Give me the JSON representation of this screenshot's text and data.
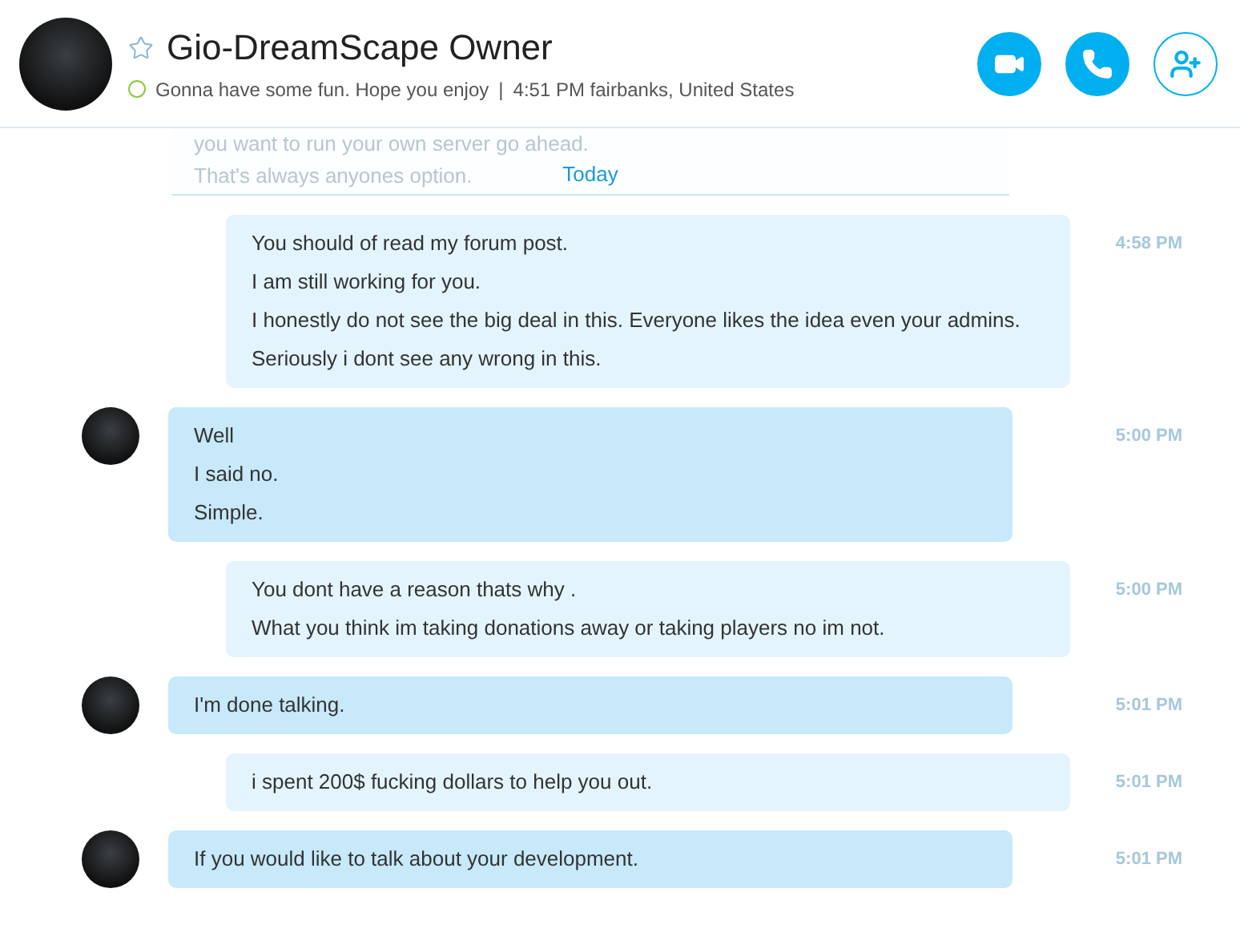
{
  "contact": {
    "name": "Gio-DreamScape Owner",
    "favorite": false,
    "online": true,
    "mood": "Gonna have some fun. Hope you enjoy",
    "separator": "|",
    "local_time": "4:51 PM fairbanks, United States"
  },
  "actions": [
    {
      "kind": "video",
      "filled": true
    },
    {
      "kind": "call",
      "filled": true
    },
    {
      "kind": "add",
      "filled": false
    }
  ],
  "earlier": {
    "lines": [
      "you want to run your own server go ahead.",
      "That's always anyones option."
    ]
  },
  "day_label": "Today",
  "messages": [
    {
      "kind": "sent",
      "time": "4:58 PM",
      "lines": [
        "You should of read my forum post.",
        "I am still working for you.",
        "I honestly do not see the big deal in this. Everyone likes the idea even your admins.",
        "Seriously i dont see any wrong in this."
      ]
    },
    {
      "kind": "received",
      "time": "5:00 PM",
      "lines": [
        "Well",
        "I said no.",
        "Simple."
      ]
    },
    {
      "kind": "sent",
      "time": "5:00 PM",
      "lines": [
        "You dont have a reason thats why .",
        "What you think im taking donations away or taking players no im not."
      ]
    },
    {
      "kind": "received",
      "time": "5:01 PM",
      "lines": [
        "I'm done talking."
      ]
    },
    {
      "kind": "sent",
      "time": "5:01 PM",
      "lines": [
        "i spent 200$ fucking dollars to help you out."
      ]
    },
    {
      "kind": "received",
      "time": "5:01 PM",
      "lines": [
        "If you would like to talk about your development."
      ]
    }
  ]
}
